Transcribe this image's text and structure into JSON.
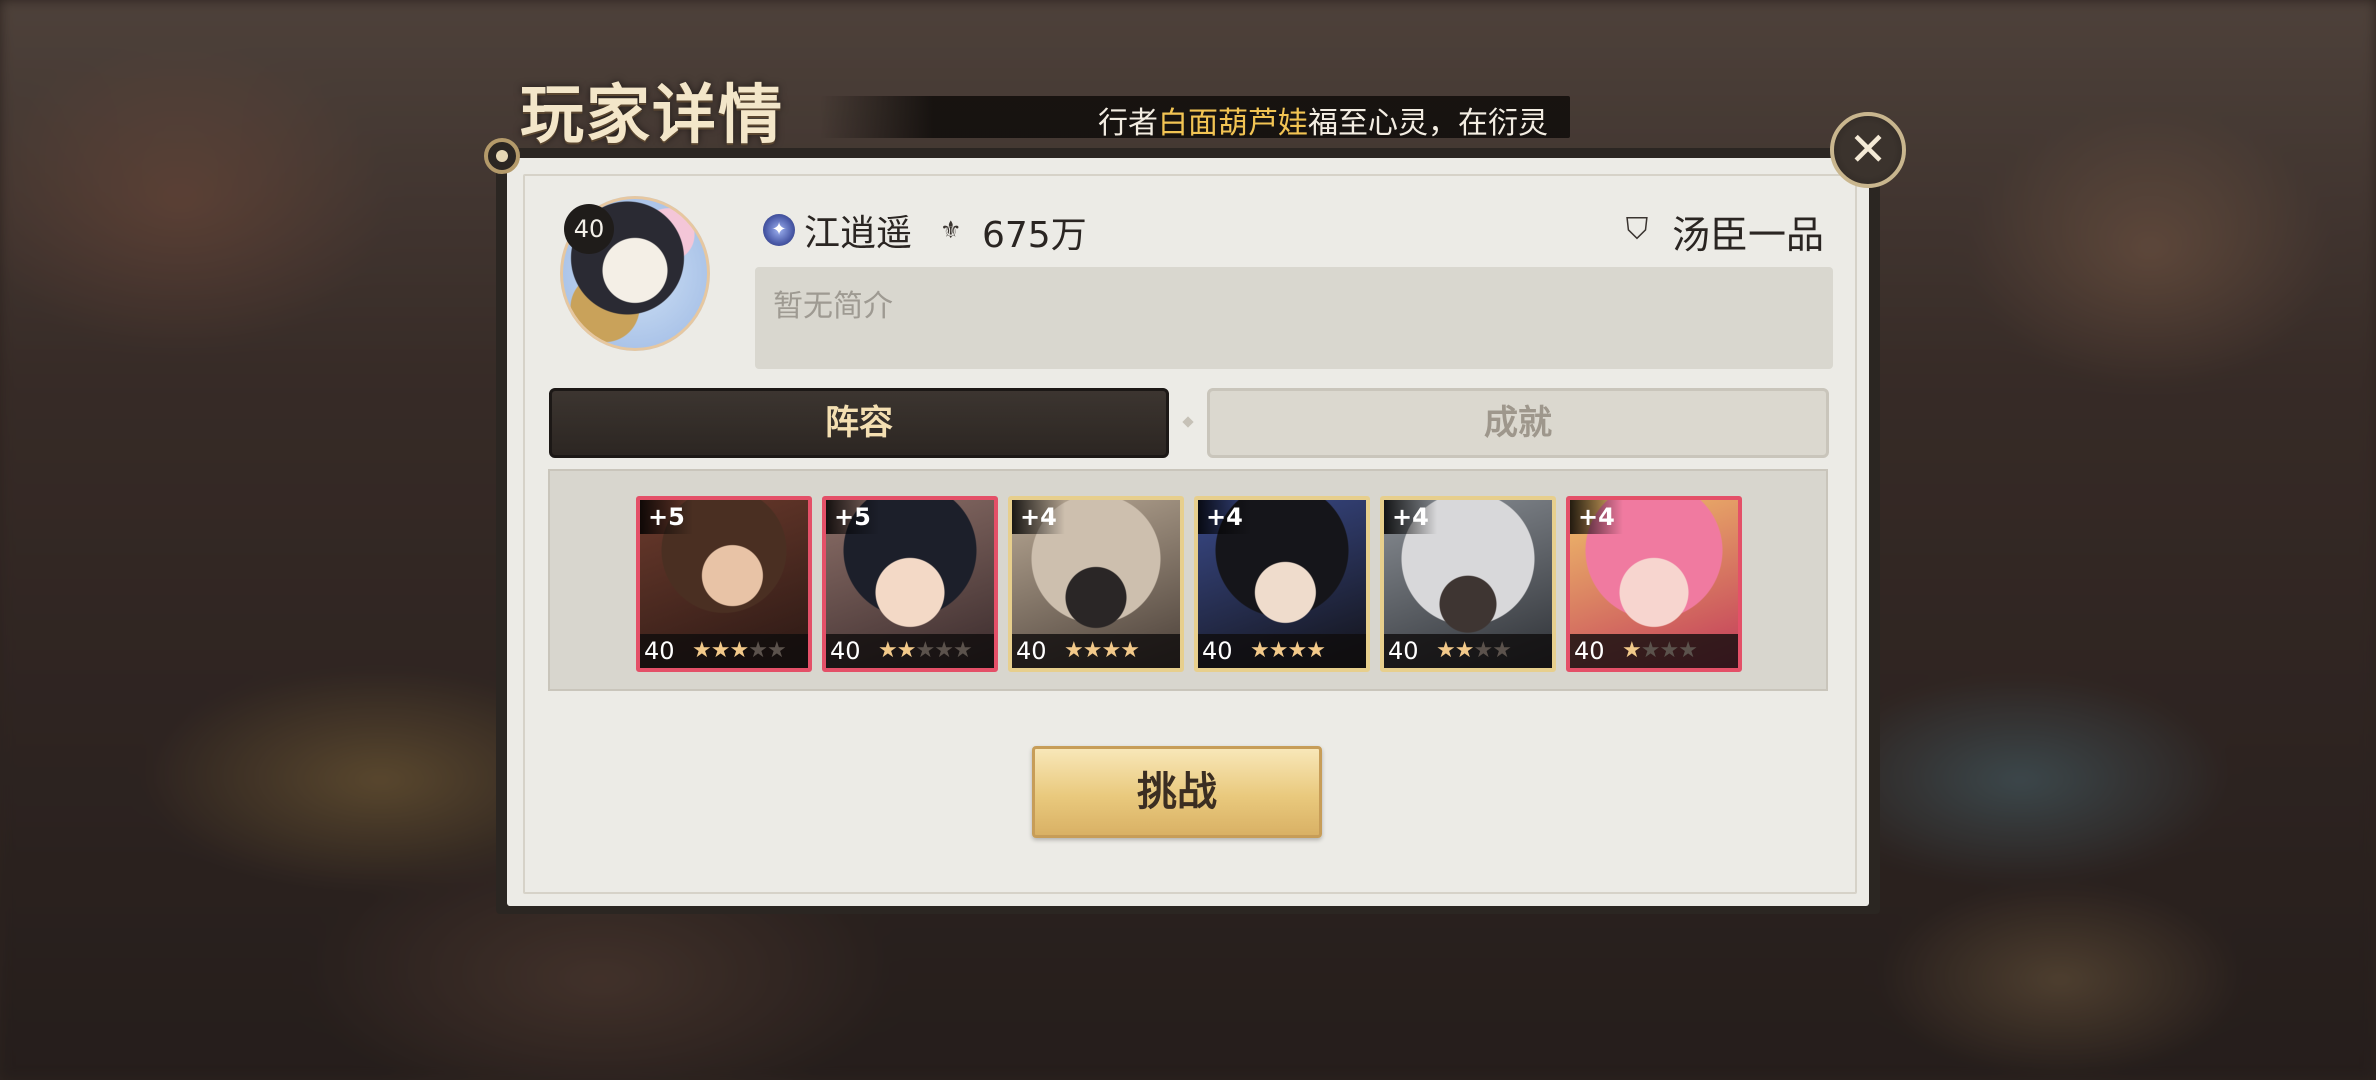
{
  "header": {
    "title": "玩家详情",
    "ticker_prefix": "行者",
    "ticker_highlight": "白面葫芦娃",
    "ticker_suffix": "福至心灵，在衍灵"
  },
  "player": {
    "avatar_level": "40",
    "name": "江逍遥",
    "power": "675万",
    "title": "汤臣一品",
    "bio_placeholder": "暂无简介"
  },
  "tabs": [
    {
      "label": "阵容",
      "active": true
    },
    {
      "label": "成就",
      "active": false
    }
  ],
  "team": [
    {
      "plus": "+5",
      "level": "40",
      "stars_filled": 3,
      "stars_total": 5,
      "frame": "red"
    },
    {
      "plus": "+5",
      "level": "40",
      "stars_filled": 2,
      "stars_total": 5,
      "frame": "red"
    },
    {
      "plus": "+4",
      "level": "40",
      "stars_filled": 4,
      "stars_total": 4,
      "frame": "gold"
    },
    {
      "plus": "+4",
      "level": "40",
      "stars_filled": 4,
      "stars_total": 4,
      "frame": "gold"
    },
    {
      "plus": "+4",
      "level": "40",
      "stars_filled": 2,
      "stars_total": 4,
      "frame": "gold"
    },
    {
      "plus": "+4",
      "level": "40",
      "stars_filled": 1,
      "stars_total": 4,
      "frame": "red"
    }
  ],
  "actions": {
    "challenge_label": "挑战"
  },
  "icons": {
    "close": "close-icon",
    "rank": "rank-icon",
    "power": "power-icon",
    "title": "title-shield-icon"
  }
}
